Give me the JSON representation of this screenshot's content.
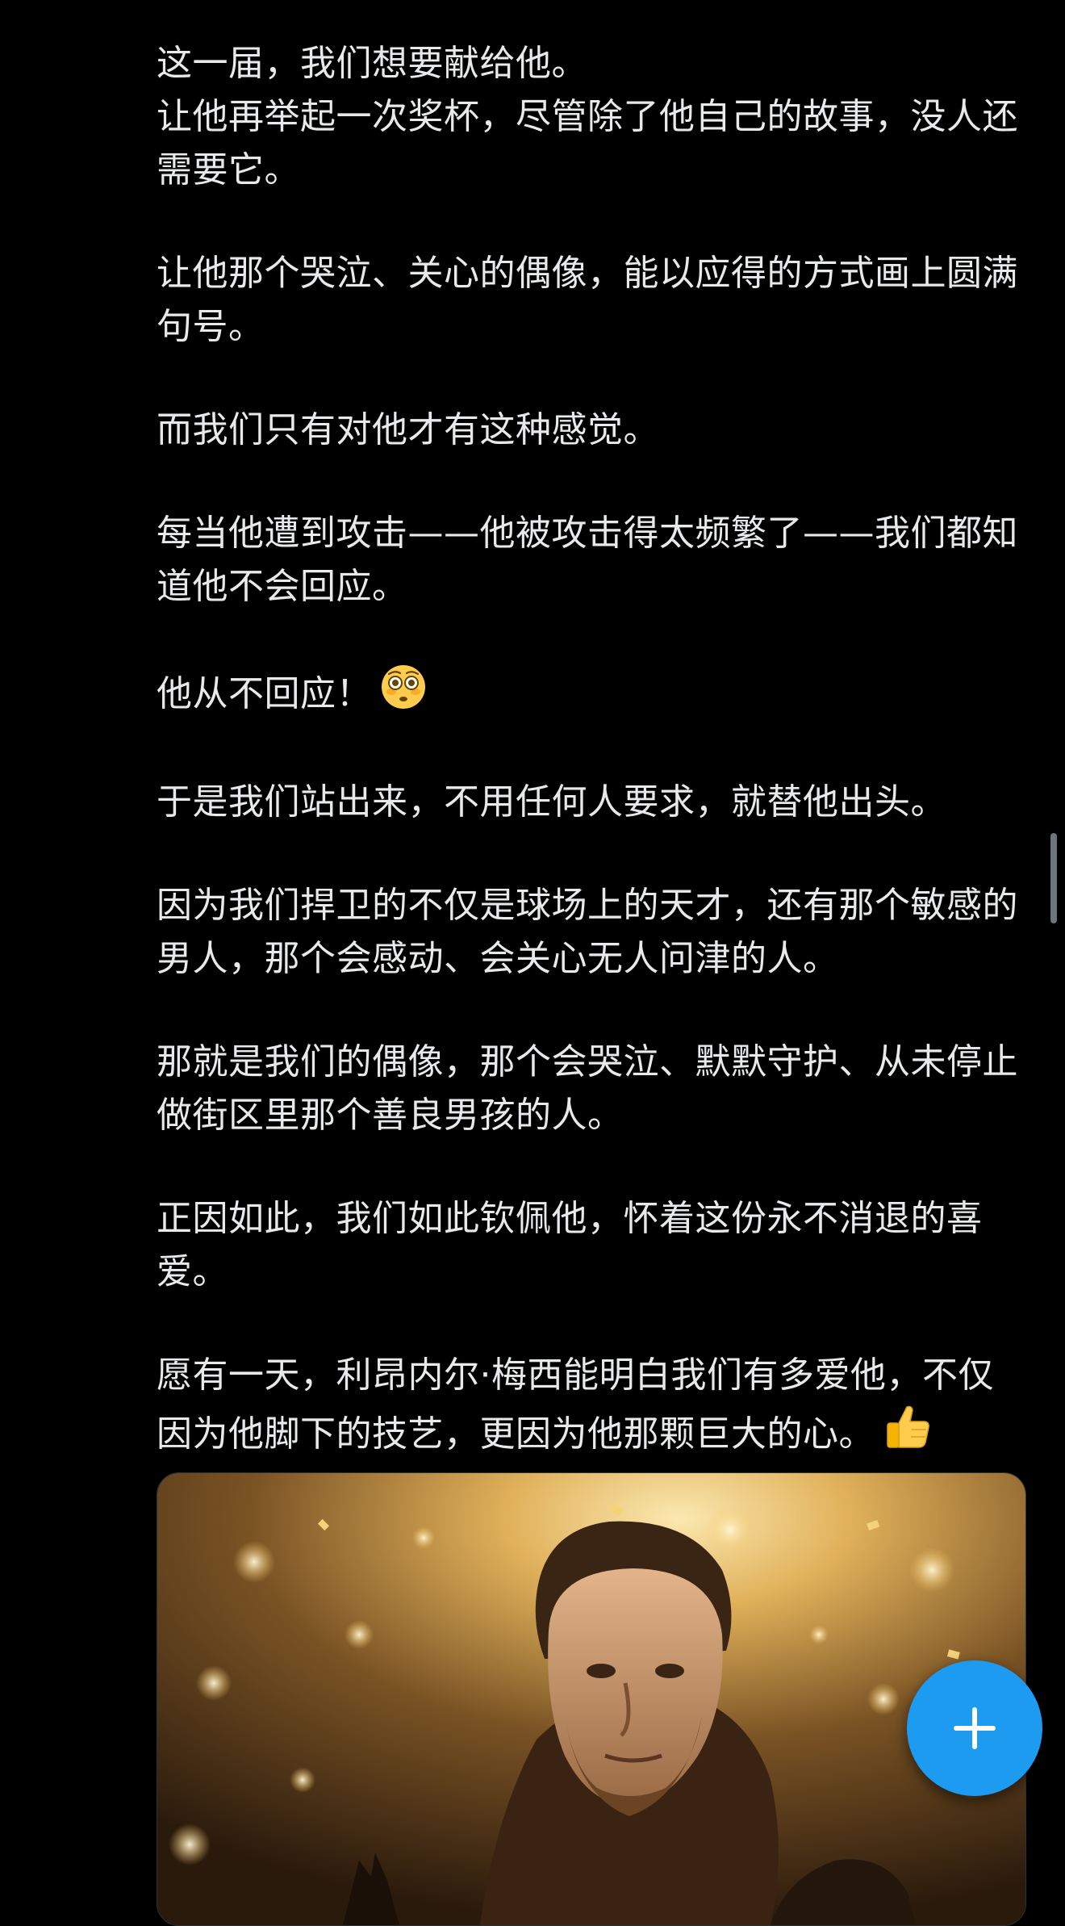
{
  "post": {
    "paragraphs": [
      "这一届，我们想要献给他。\n让他再举起一次奖杯，尽管除了他自己的故事，没人还需要它。",
      "让他那个哭泣、关心的偶像，能以应得的方式画上圆满句号。",
      "而我们只有对他才有这种感觉。",
      "每当他遭到攻击——他被攻击得太频繁了——我们都知道他不会回应。",
      "他从不回应！",
      "于是我们站出来，不用任何人要求，就替他出头。",
      "因为我们捍卫的不仅是球场上的天才，还有那个敏感的男人，那个会感动、会关心无人问津的人。",
      "那就是我们的偶像，那个会哭泣、默默守护、从未停止做街区里那个善良男孩的人。",
      "正因如此，我们如此钦佩他，怀着这份永不消退的喜爱。",
      "愿有一天，利昂内尔·梅西能明白我们有多爱他，不仅因为他脚下的技艺，更因为他那颗巨大的心。"
    ],
    "emojis": {
      "flushed": "flushed-face-emoji",
      "thumbs_up": "thumbs-up-emoji"
    },
    "media": {
      "kind": "photo"
    }
  },
  "fab": {
    "icon": "plus-icon",
    "color": "#1d9bf0"
  },
  "theme": {
    "background": "#000000",
    "text": "#e7e9ea",
    "accent": "#1d9bf0"
  }
}
